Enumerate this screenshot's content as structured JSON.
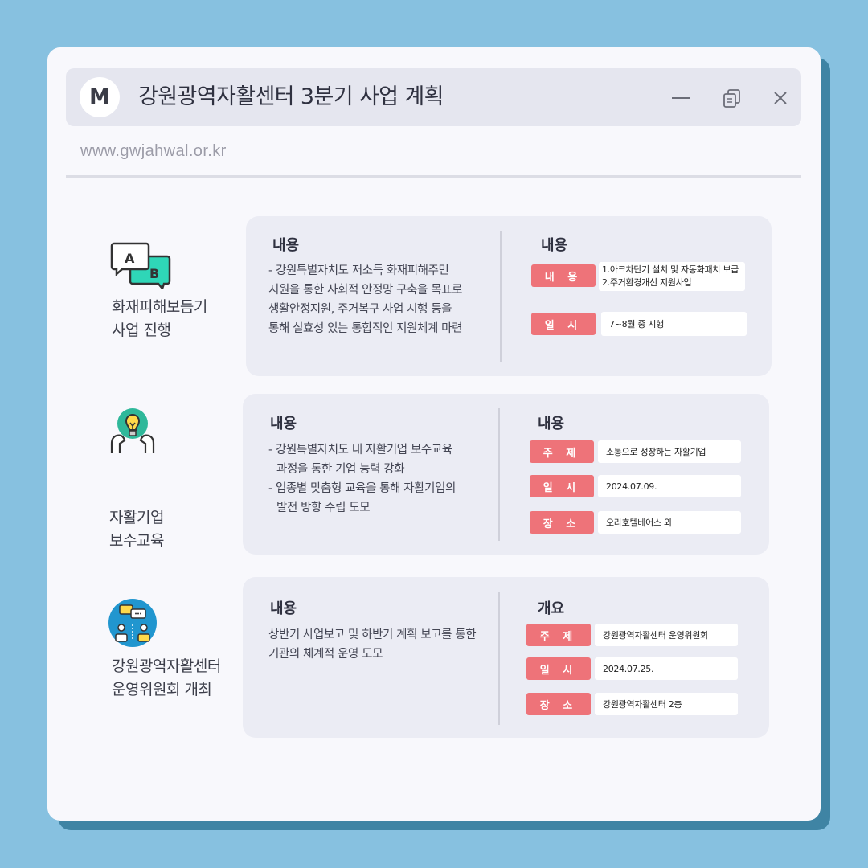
{
  "window": {
    "logo": "M",
    "title": "강원광역자활센터 3분기 사업 계획",
    "url": "www.gwjahwal.or.kr"
  },
  "sections": [
    {
      "icon": "translate-chat-icon",
      "label_line1": "화재피해보듬기",
      "label_line2": "사업 진행",
      "left_heading": "내용",
      "desc": [
        "- 강원특별자치도 저소득 화재피해주민",
        "지원을 통한 사회적 안정망 구축을 목표로",
        "생활안정지원, 주거복구 사업 시행 등을",
        "통해 실효성 있는 통합적인 지원체계 마련"
      ],
      "right_heading": "내용",
      "rows": [
        {
          "tag": "내 용",
          "value_line1": "1.아크차단기 설치 및 자동화패치 보급",
          "value_line2": "2.주거환경개선 지원사업"
        },
        {
          "tag": "일 시",
          "value": "7~8월 중 시행"
        }
      ]
    },
    {
      "icon": "lightbulb-heads-icon",
      "label_line1": "자활기업",
      "label_line2": "보수교육",
      "left_heading": "내용",
      "desc": [
        "- 강원특별자치도 내 자활기업 보수교육",
        "과정을 통한 기업 능력 강화",
        "- 업종별 맞춤형 교육을 통해 자활기업의",
        "발전 방향 수립 도모"
      ],
      "right_heading": "내용",
      "rows": [
        {
          "tag": "주 제",
          "value": "소통으로 성장하는 자활기업"
        },
        {
          "tag": "일 시",
          "value": "2024.07.09."
        },
        {
          "tag": "장 소",
          "value": "오라호텔베어스 외"
        }
      ]
    },
    {
      "icon": "meeting-people-icon",
      "label_line1": "강원광역자활센터",
      "label_line2": "운영위원회 개최",
      "left_heading": "내용",
      "desc": [
        "상반기 사업보고 및 하반기 계획 보고를 통한",
        "기관의 체계적 운영 도모"
      ],
      "right_heading": "개요",
      "rows": [
        {
          "tag": "주 제",
          "value": "강원광역자활센터 운영위원회"
        },
        {
          "tag": "일 시",
          "value": "2024.07.25."
        },
        {
          "tag": "장 소",
          "value": "강원광역자활센터 2층"
        }
      ]
    }
  ],
  "colors": {
    "background": "#87c1e0",
    "shadow": "#3f84a4",
    "tag": "#ee7379",
    "card": "#ebecf4"
  }
}
